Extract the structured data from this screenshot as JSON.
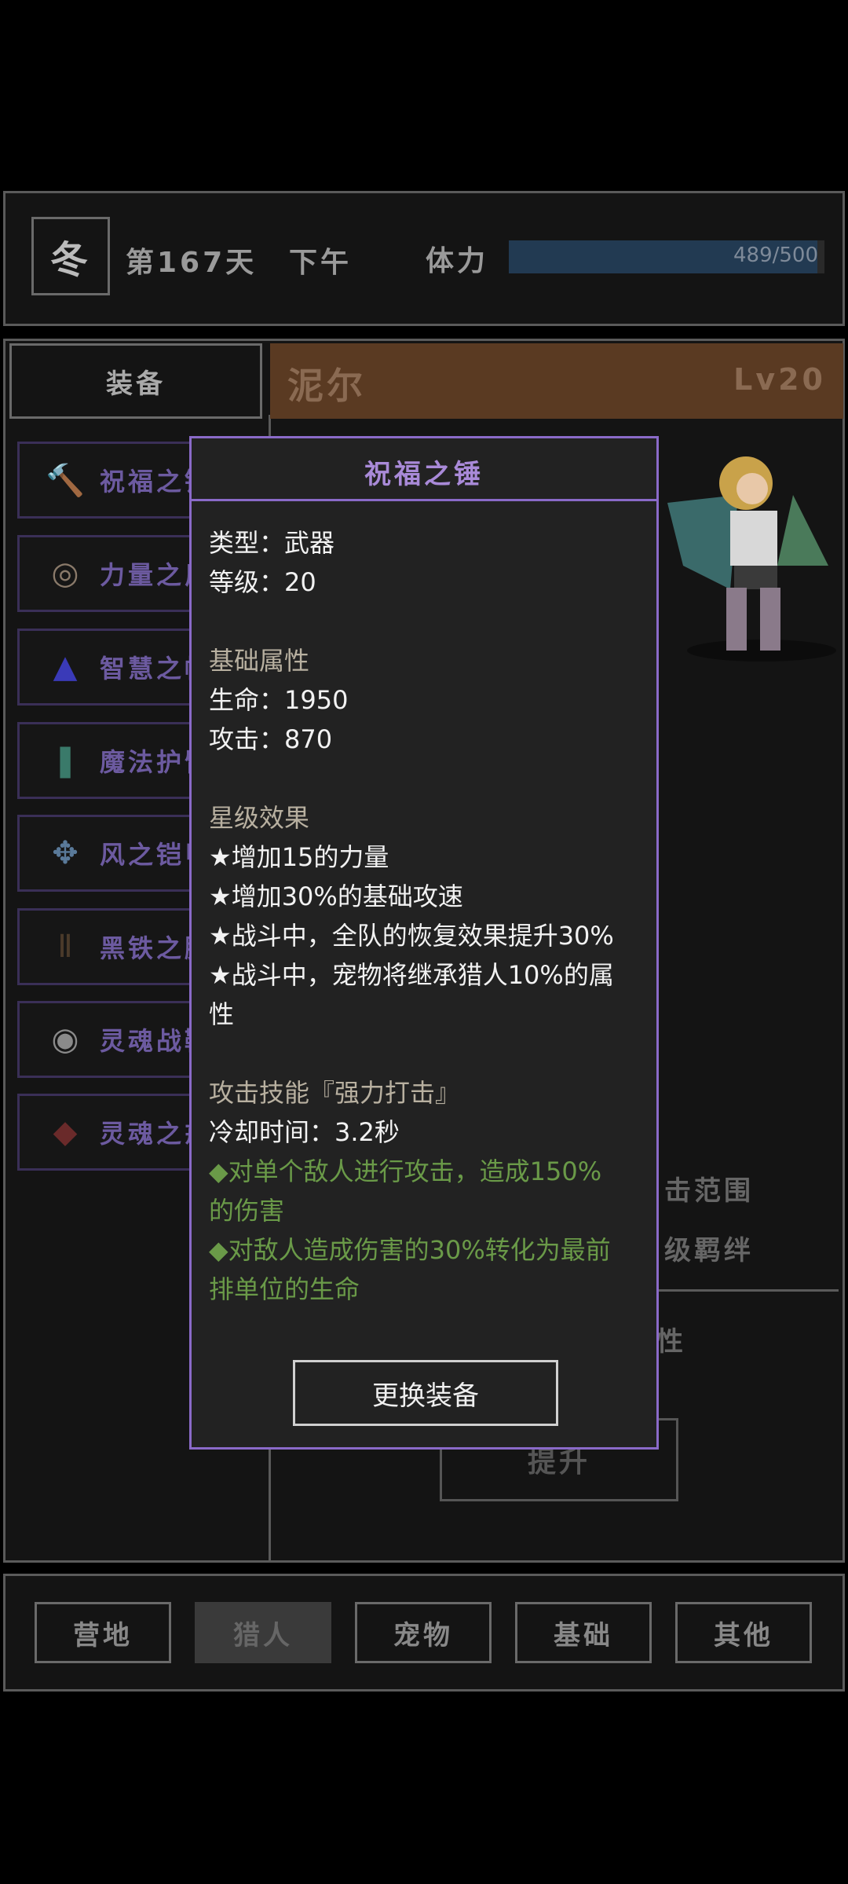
{
  "header": {
    "season": "冬",
    "day": "第167天",
    "time_of_day": "下午",
    "stamina_label": "体力",
    "stamina_text": "489/500",
    "stamina_fraction": 0.978
  },
  "equip_tab": "装备",
  "hero": {
    "name": "泥尔",
    "level": "Lv20"
  },
  "items": [
    {
      "label": "祝福之锤",
      "icon": "hammer-icon",
      "glyph": "🔨"
    },
    {
      "label": "力量之盾",
      "icon": "shield-icon",
      "glyph": "◎"
    },
    {
      "label": "智慧之帽",
      "icon": "wizard-hat-icon",
      "glyph": "▲"
    },
    {
      "label": "魔法护臂",
      "icon": "bracer-icon",
      "glyph": "❚"
    },
    {
      "label": "风之铠甲",
      "icon": "armor-icon",
      "glyph": "✥"
    },
    {
      "label": "黑铁之腿",
      "icon": "leg-armor-icon",
      "glyph": "Ⅱ"
    },
    {
      "label": "灵魂战靴",
      "icon": "boots-icon",
      "glyph": "◉"
    },
    {
      "label": "灵魂之戒",
      "icon": "ring-icon",
      "glyph": "◆"
    }
  ],
  "right_faint": {
    "range": "击范围",
    "bond": "级羁绊",
    "attr": "性",
    "upgrade": "提升"
  },
  "popup": {
    "title": "祝福之锤",
    "type": "类型：武器",
    "level": "等级：20",
    "base_title": "基础属性",
    "hp": "生命：1950",
    "atk": "攻击：870",
    "star_title": "星级效果",
    "star1": "★增加15的力量",
    "star2": "★增加30%的基础攻速",
    "star3": "★战斗中，全队的恢复效果提升30%",
    "star4a": "★战斗中，宠物将继承猎人10%的属",
    "star4b": "性",
    "skill_title": "攻击技能『强力打击』",
    "cooldown": "冷却时间：3.2秒",
    "eff1a": "◆对单个敌人进行攻击，造成150%",
    "eff1b": "的伤害",
    "eff2a": "◆对敌人造成伤害的30%转化为最前",
    "eff2b": "排单位的生命",
    "button": "更换装备"
  },
  "nav": [
    "营地",
    "猎人",
    "宠物",
    "基础",
    "其他"
  ],
  "nav_active": "猎人"
}
